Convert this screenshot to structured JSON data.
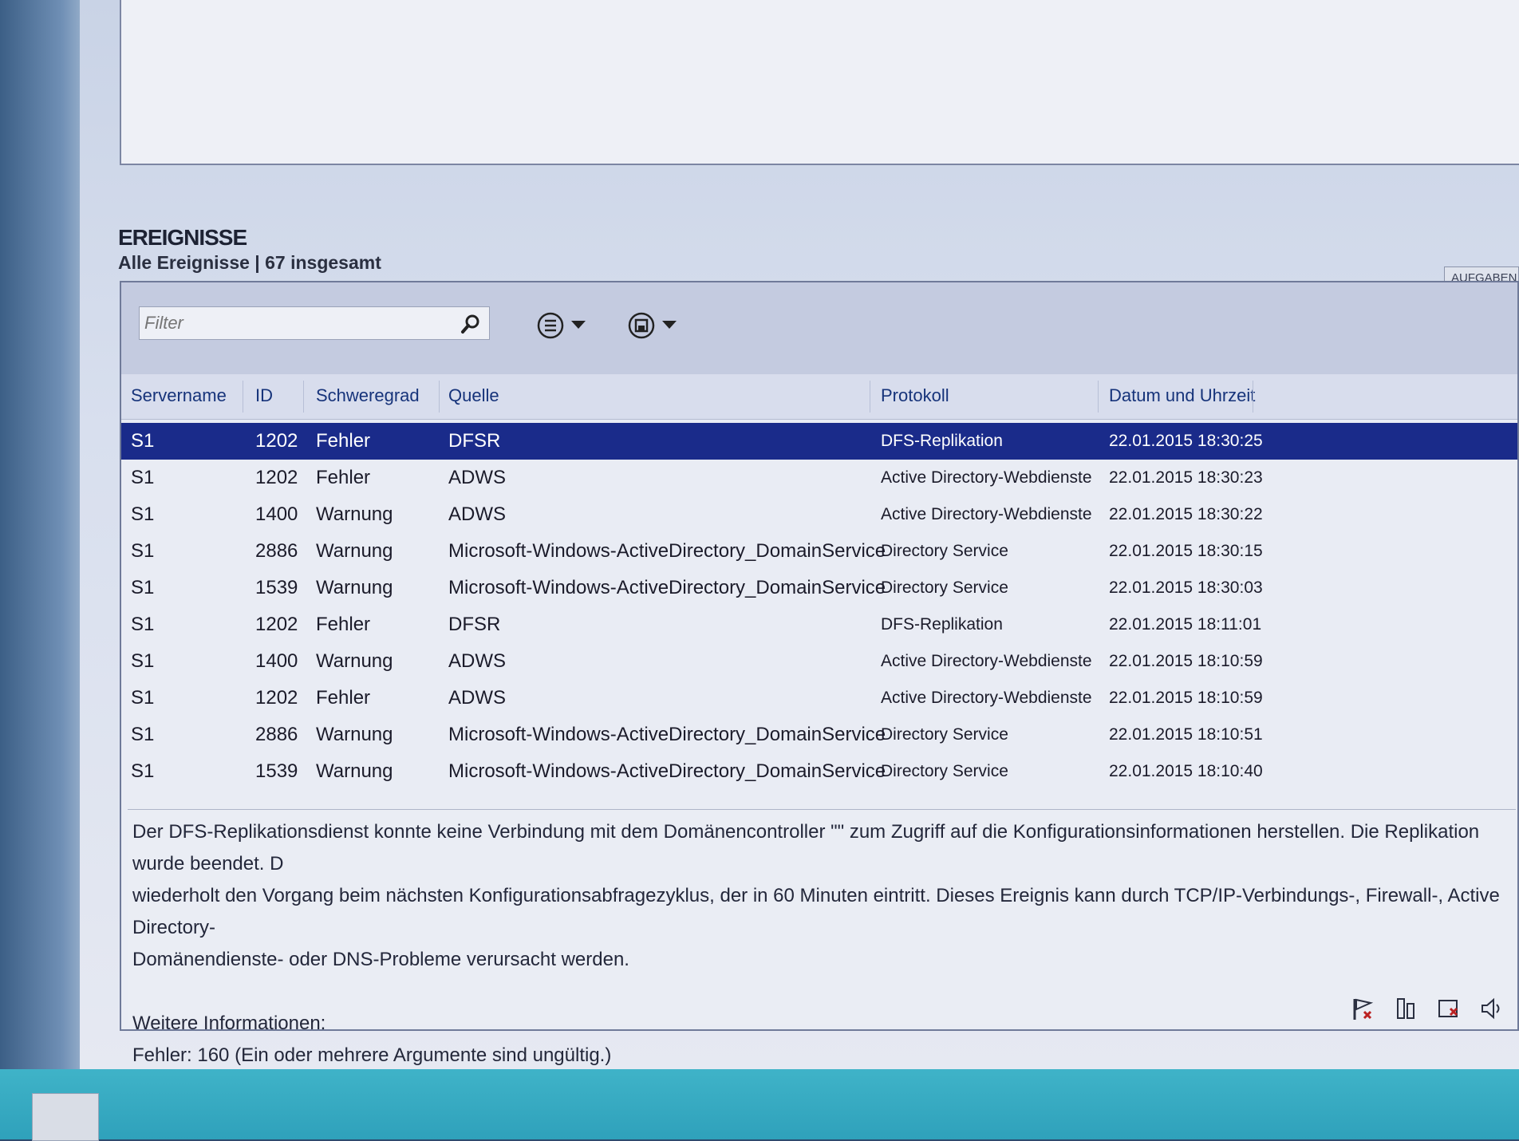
{
  "section": {
    "title": "EREIGNISSE",
    "subtitle": "Alle Ereignisse | 67 insgesamt",
    "tasks_label": "AUFGABEN"
  },
  "toolbar": {
    "filter_placeholder": "Filter",
    "search_icon": "search-icon",
    "view_menu_icon": "list-options-icon",
    "save_query_icon": "save-query-icon"
  },
  "columns": [
    "Servername",
    "ID",
    "Schweregrad",
    "Quelle",
    "Protokoll",
    "Datum und Uhrzeit"
  ],
  "events": [
    {
      "server": "S1",
      "id": "1202",
      "severity": "Fehler",
      "source": "DFSR",
      "log": "DFS-Replikation",
      "datetime": "22.01.2015 18:30:25",
      "selected": true
    },
    {
      "server": "S1",
      "id": "1202",
      "severity": "Fehler",
      "source": "ADWS",
      "log": "Active Directory-Webdienste",
      "datetime": "22.01.2015 18:30:23"
    },
    {
      "server": "S1",
      "id": "1400",
      "severity": "Warnung",
      "source": "ADWS",
      "log": "Active Directory-Webdienste",
      "datetime": "22.01.2015 18:30:22"
    },
    {
      "server": "S1",
      "id": "2886",
      "severity": "Warnung",
      "source": "Microsoft-Windows-ActiveDirectory_DomainService",
      "log": "Directory Service",
      "datetime": "22.01.2015 18:30:15"
    },
    {
      "server": "S1",
      "id": "1539",
      "severity": "Warnung",
      "source": "Microsoft-Windows-ActiveDirectory_DomainService",
      "log": "Directory Service",
      "datetime": "22.01.2015 18:30:03"
    },
    {
      "server": "S1",
      "id": "1202",
      "severity": "Fehler",
      "source": "DFSR",
      "log": "DFS-Replikation",
      "datetime": "22.01.2015 18:11:01"
    },
    {
      "server": "S1",
      "id": "1400",
      "severity": "Warnung",
      "source": "ADWS",
      "log": "Active Directory-Webdienste",
      "datetime": "22.01.2015 18:10:59"
    },
    {
      "server": "S1",
      "id": "1202",
      "severity": "Fehler",
      "source": "ADWS",
      "log": "Active Directory-Webdienste",
      "datetime": "22.01.2015 18:10:59"
    },
    {
      "server": "S1",
      "id": "2886",
      "severity": "Warnung",
      "source": "Microsoft-Windows-ActiveDirectory_DomainService",
      "log": "Directory Service",
      "datetime": "22.01.2015 18:10:51"
    },
    {
      "server": "S1",
      "id": "1539",
      "severity": "Warnung",
      "source": "Microsoft-Windows-ActiveDirectory_DomainService",
      "log": "Directory Service",
      "datetime": "22.01.2015 18:10:40"
    }
  ],
  "details": {
    "line1": "Der DFS-Replikationsdienst konnte keine Verbindung mit dem Domänencontroller \"\" zum Zugriff auf die Konfigurationsinformationen herstellen. Die Replikation wurde beendet. D",
    "line2": "wiederholt den Vorgang beim nächsten Konfigurationsabfragezyklus, der in 60 Minuten eintritt. Dieses Ereignis kann durch TCP/IP-Verbindungs-, Firewall-, Active Directory-",
    "line3": "Domänendienste- oder DNS-Probleme verursacht werden.",
    "line4": "",
    "line5": "Weitere Informationen:",
    "line6": "Fehler: 160 (Ein oder mehrere Argumente sind ungültig.)"
  },
  "tray_icons": [
    "notification-flag-icon",
    "network-icon",
    "action-center-icon",
    "volume-icon"
  ],
  "colors": {
    "selection": "#1a2b8a",
    "taskbar": "#3fb3c8",
    "header_text": "#16337a"
  }
}
